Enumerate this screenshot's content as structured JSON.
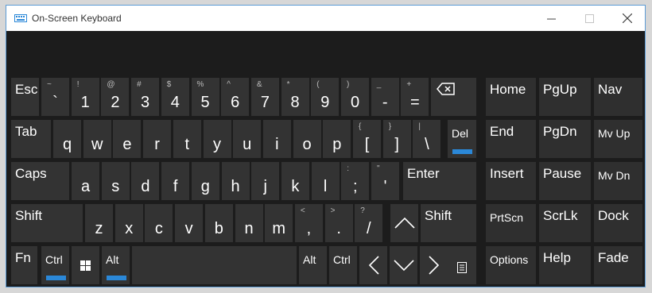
{
  "window": {
    "title": "On-Screen Keyboard",
    "controls": [
      "minimize",
      "maximize",
      "close"
    ]
  },
  "keys": {
    "esc": "Esc",
    "tab": "Tab",
    "caps": "Caps",
    "shift": "Shift",
    "fn": "Fn",
    "ctrl": "Ctrl",
    "alt": "Alt",
    "alt_gr": "Alt",
    "ctrl_right": "Ctrl",
    "enter": "Enter",
    "shift_right": "Shift",
    "del": "Del",
    "home": "Home",
    "pgup": "PgUp",
    "nav": "Nav",
    "end": "End",
    "pgdn": "PgDn",
    "mvup": "Mv Up",
    "insert": "Insert",
    "pause": "Pause",
    "mvdn": "Mv Dn",
    "prtscn": "PrtScn",
    "scrlk": "ScrLk",
    "dock": "Dock",
    "options": "Options",
    "help": "Help",
    "fade": "Fade",
    "row1": [
      {
        "shift": "~",
        "main": "`"
      },
      {
        "shift": "!",
        "main": "1"
      },
      {
        "shift": "@",
        "main": "2"
      },
      {
        "shift": "#",
        "main": "3"
      },
      {
        "shift": "$",
        "main": "4"
      },
      {
        "shift": "%",
        "main": "5"
      },
      {
        "shift": "^",
        "main": "6"
      },
      {
        "shift": "&",
        "main": "7"
      },
      {
        "shift": "*",
        "main": "8"
      },
      {
        "shift": "(",
        "main": "9"
      },
      {
        "shift": ")",
        "main": "0"
      },
      {
        "shift": "_",
        "main": "-"
      },
      {
        "shift": "+",
        "main": "="
      }
    ],
    "row2": [
      {
        "main": "q"
      },
      {
        "main": "w"
      },
      {
        "main": "e"
      },
      {
        "main": "r"
      },
      {
        "main": "t"
      },
      {
        "main": "y"
      },
      {
        "main": "u"
      },
      {
        "main": "i"
      },
      {
        "main": "o"
      },
      {
        "main": "p"
      },
      {
        "shift": "{",
        "main": "["
      },
      {
        "shift": "}",
        "main": "]"
      },
      {
        "shift": "|",
        "main": "\\"
      }
    ],
    "row3": [
      {
        "main": "a"
      },
      {
        "main": "s"
      },
      {
        "main": "d"
      },
      {
        "main": "f"
      },
      {
        "main": "g"
      },
      {
        "main": "h"
      },
      {
        "main": "j"
      },
      {
        "main": "k"
      },
      {
        "main": "l"
      },
      {
        "shift": ":",
        "main": ";"
      },
      {
        "shift": "\"",
        "main": "'"
      }
    ],
    "row4": [
      {
        "main": "z"
      },
      {
        "main": "x"
      },
      {
        "main": "c"
      },
      {
        "main": "v"
      },
      {
        "main": "b"
      },
      {
        "main": "n"
      },
      {
        "main": "m"
      },
      {
        "shift": "<",
        "main": ","
      },
      {
        "shift": ">",
        "main": "."
      },
      {
        "shift": "?",
        "main": "/"
      }
    ]
  },
  "toggle_indicators": {
    "del": true,
    "ctrl": true,
    "alt": true,
    "color": "#2b88d8"
  },
  "icons": [
    "keyboard-icon",
    "minimize-icon",
    "maximize-icon",
    "close-icon",
    "backspace-icon",
    "windows-icon",
    "up-arrow-icon",
    "down-arrow-icon",
    "left-arrow-icon",
    "right-arrow-icon",
    "menu-key-icon"
  ]
}
